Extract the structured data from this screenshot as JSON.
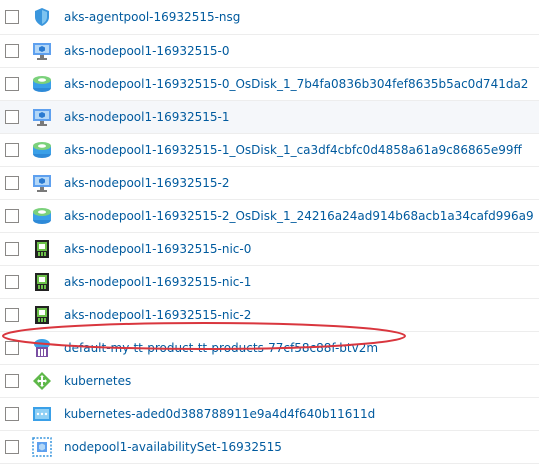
{
  "resources": [
    {
      "name": "aks-agentpool-16932515-nsg",
      "icon": "network-security-group-icon"
    },
    {
      "name": "aks-nodepool1-16932515-0",
      "icon": "virtual-machine-icon"
    },
    {
      "name": "aks-nodepool1-16932515-0_OsDisk_1_7b4fa0836b304fef8635b5ac0d741da2",
      "icon": "disk-icon"
    },
    {
      "name": "aks-nodepool1-16932515-1",
      "icon": "virtual-machine-icon"
    },
    {
      "name": "aks-nodepool1-16932515-1_OsDisk_1_ca3df4cbfc0d4858a61a9c86865e99ff",
      "icon": "disk-icon"
    },
    {
      "name": "aks-nodepool1-16932515-2",
      "icon": "virtual-machine-icon"
    },
    {
      "name": "aks-nodepool1-16932515-2_OsDisk_1_24216a24ad914b68acb1a34cafd996a9",
      "icon": "disk-icon"
    },
    {
      "name": "aks-nodepool1-16932515-nic-0",
      "icon": "network-interface-icon"
    },
    {
      "name": "aks-nodepool1-16932515-nic-1",
      "icon": "network-interface-icon"
    },
    {
      "name": "aks-nodepool1-16932515-nic-2",
      "icon": "network-interface-icon"
    },
    {
      "name": "default-my-tt-product-tt-products-77cf58c88f-btv2m",
      "icon": "public-ip-icon"
    },
    {
      "name": "kubernetes",
      "icon": "load-balancer-icon"
    },
    {
      "name": "kubernetes-aded0d388788911e9a4d4f640b11611d",
      "icon": "public-ip-address-icon"
    },
    {
      "name": "nodepool1-availabilitySet-16932515",
      "icon": "availability-set-icon"
    }
  ],
  "colors": {
    "link": "#005a9e",
    "highlight_ellipse": "#d9363e",
    "hover_row": "#f5f7fa"
  }
}
